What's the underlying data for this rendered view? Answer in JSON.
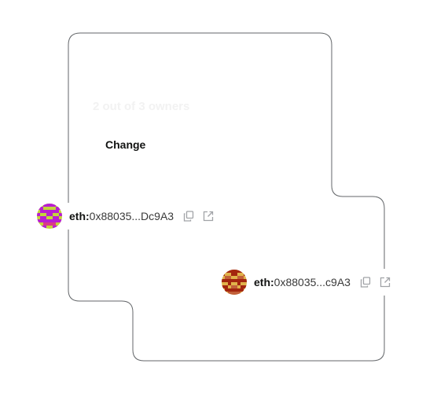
{
  "threshold": {
    "text": "2 out of 3 owners"
  },
  "change_button": {
    "label": "Change"
  },
  "owners": [
    {
      "prefix": "eth:",
      "address": "0x88035...Dc9A3",
      "avatar_colors": [
        "#c4d43a",
        "#b81ed1",
        "#d93a8a"
      ]
    },
    {
      "prefix": "eth:",
      "address": "0x88035...c9A3",
      "avatar_colors": [
        "#e0b24a",
        "#a3260f",
        "#c2603a"
      ]
    }
  ],
  "icons": {
    "copy": "copy-icon",
    "external_link": "external-link-icon"
  },
  "colors": {
    "text": "#121312",
    "frame_stroke": "#636669",
    "icon": "#a1a3a7",
    "threshold_text": "#f2f2f2"
  }
}
